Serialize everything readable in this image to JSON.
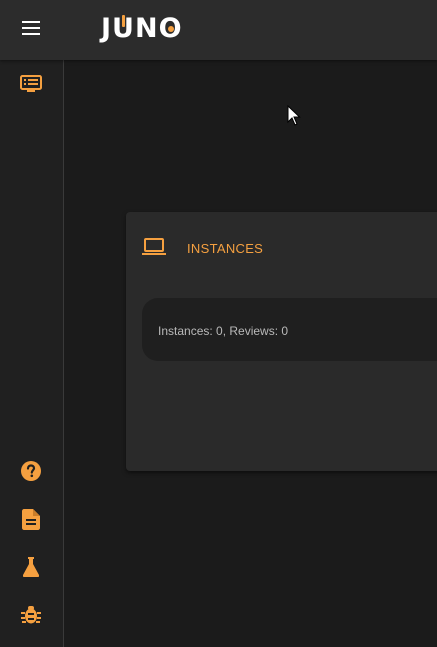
{
  "app": {
    "logo_text": {
      "j": "J",
      "u": "U",
      "n": "N",
      "o": "O"
    },
    "accent_color": "#f5a040"
  },
  "topbar": {
    "menu_icon": "hamburger-menu-icon"
  },
  "sidebar": {
    "top_items": [
      {
        "icon": "list-view-icon"
      }
    ],
    "bottom_items": [
      {
        "icon": "help-circle-icon"
      },
      {
        "icon": "document-icon"
      },
      {
        "icon": "flask-icon"
      },
      {
        "icon": "bug-icon"
      }
    ]
  },
  "card": {
    "icon": "laptop-icon",
    "title": "INSTANCES",
    "summary": "Instances: 0, Reviews: 0"
  }
}
